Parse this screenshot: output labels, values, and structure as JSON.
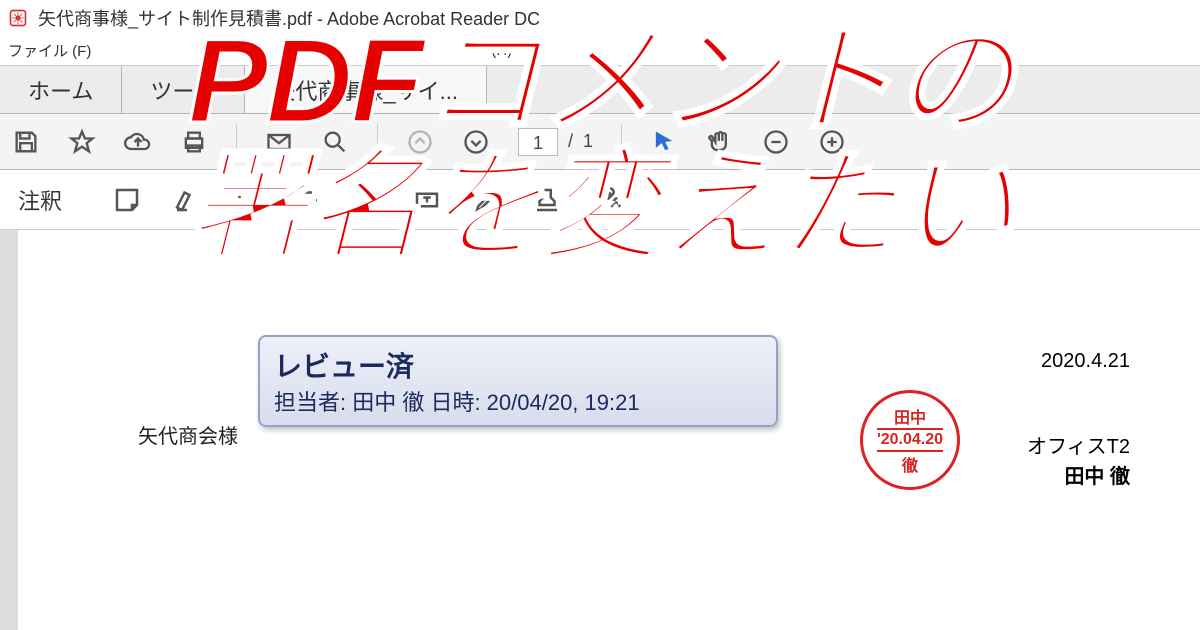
{
  "titlebar": {
    "title": "矢代商事様_サイト制作見積書.pdf - Adobe Acrobat Reader DC"
  },
  "menubar": {
    "file": "ファイル (F)",
    "help_suffix": "(H)"
  },
  "tabs": {
    "home": "ホーム",
    "tools": "ツール",
    "doc": "矢代商事様_サイ..."
  },
  "toolbar": {
    "page_current": "1",
    "page_total": "1",
    "sep": "/"
  },
  "annotations": {
    "label": "注釈"
  },
  "document": {
    "client": "矢代商会様",
    "comment_status": "レビュー済",
    "comment_meta": "担当者: 田中 徹 日時: 20/04/20, 19:21",
    "date": "2020.4.21",
    "office": "オフィスT2",
    "signer": "田中 徹",
    "stamp_top": "田中",
    "stamp_date": "'20.04.20",
    "stamp_bottom": "徹"
  },
  "overlay": {
    "line1": "PDFコメントの",
    "line2": "署名を変えたい"
  }
}
